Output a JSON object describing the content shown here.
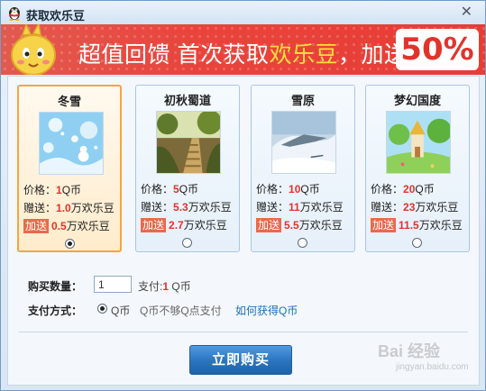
{
  "window": {
    "title": "获取欢乐豆",
    "close_glyph": "✕"
  },
  "banner": {
    "text_before": "超值回馈 首次获取",
    "text_highlight": "欢乐豆",
    "text_after": "，加送",
    "percent": "50%"
  },
  "labels": {
    "price": "价格：",
    "bonus": "赠送：",
    "extra_tag": "加送",
    "q_unit": "Q币",
    "wan_unit": "万欢乐豆"
  },
  "packages": [
    {
      "name": "冬雪",
      "price": "1",
      "bonus": "1.0",
      "extra": "0.5",
      "selected": true
    },
    {
      "name": "初秋蜀道",
      "price": "5",
      "bonus": "5.3",
      "extra": "2.7",
      "selected": false
    },
    {
      "name": "雪原",
      "price": "10",
      "bonus": "11",
      "extra": "5.5",
      "selected": false
    },
    {
      "name": "梦幻国度",
      "price": "20",
      "bonus": "23",
      "extra": "11.5",
      "selected": false
    }
  ],
  "purchase": {
    "quantity_label": "购买数量：",
    "quantity_value": "1",
    "pay_prefix": "支付:",
    "pay_amount": "1",
    "pay_unit": "Q币"
  },
  "payment": {
    "label": "支付方式：",
    "option_qb": "Q币",
    "insufficient": "Q币不够Q点支付",
    "how_link": "如何获得Q币"
  },
  "buy_button": "立即购买",
  "watermark": {
    "main": "Bai 经验",
    "sub": "jingyan.baidu.com"
  }
}
